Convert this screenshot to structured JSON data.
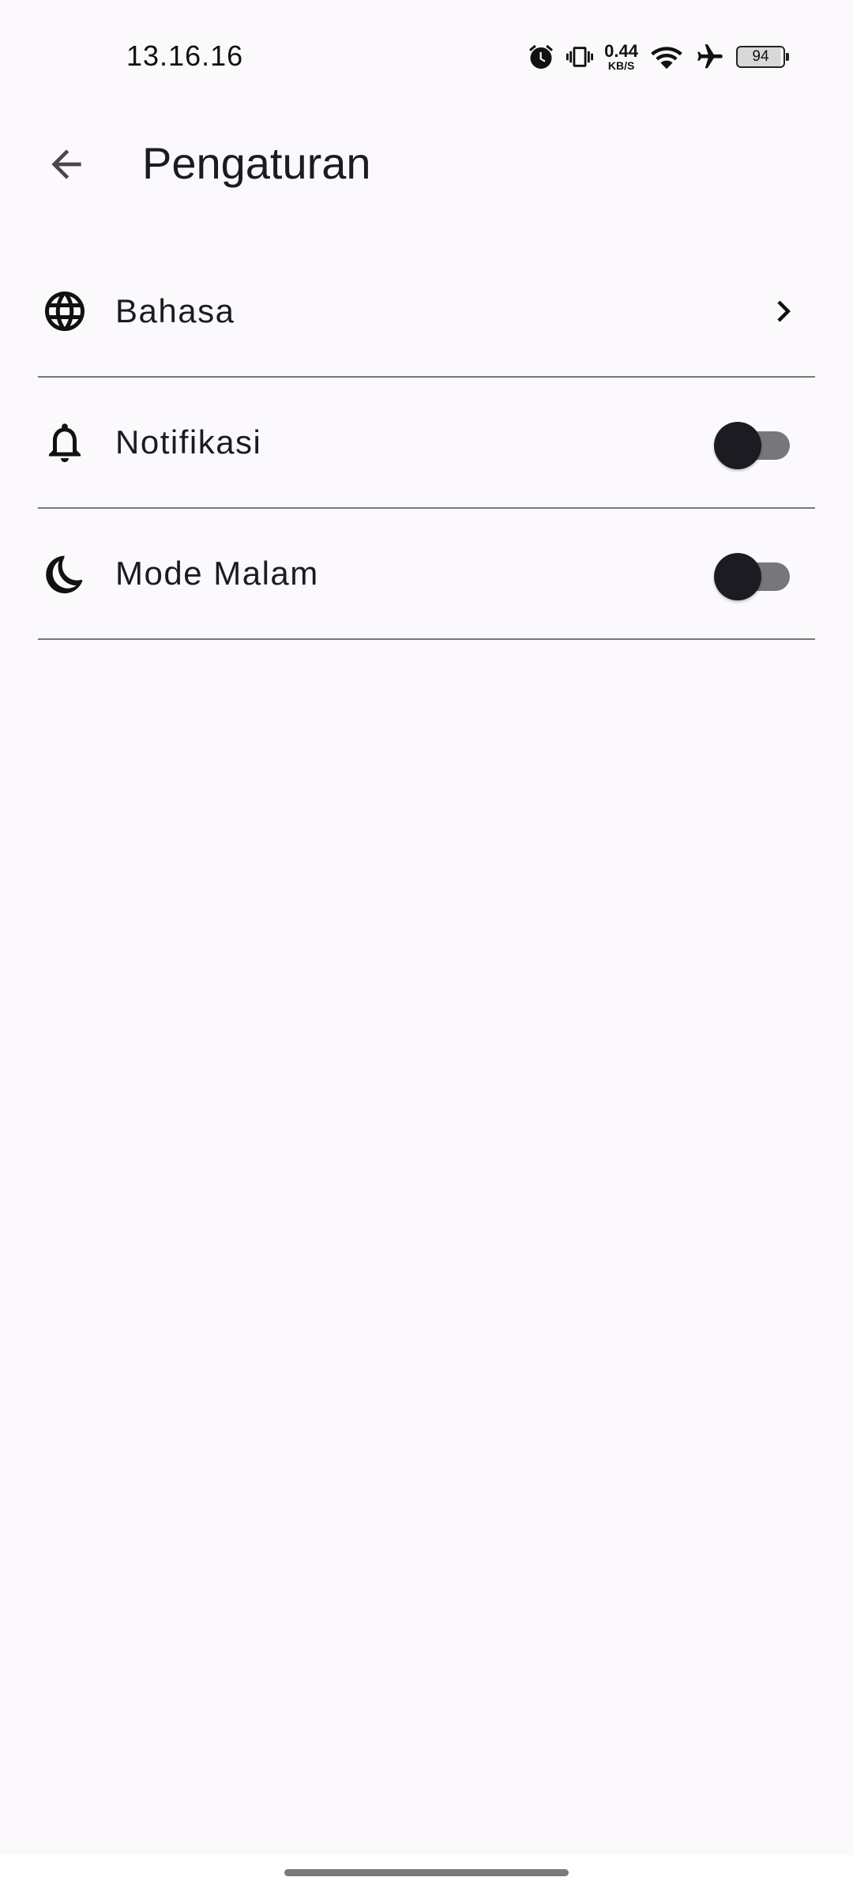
{
  "status_bar": {
    "time": "13.16.16",
    "net_speed_value": "0.44",
    "net_speed_unit": "KB/S",
    "battery_level": "94",
    "icons": [
      "alarm-icon",
      "vibrate-icon",
      "wifi-icon",
      "airplane-icon",
      "battery-icon"
    ]
  },
  "app_bar": {
    "title": "Pengaturan",
    "back_icon": "arrow-back-icon"
  },
  "settings": {
    "items": [
      {
        "label": "Bahasa",
        "icon": "globe-icon",
        "control": "chevron"
      },
      {
        "label": "Notifikasi",
        "icon": "bell-icon",
        "control": "switch",
        "enabled": false
      },
      {
        "label": "Mode Malam",
        "icon": "moon-icon",
        "control": "switch",
        "enabled": false
      }
    ]
  },
  "colors": {
    "background": "#fcf9fc",
    "text": "#1c1b1f",
    "divider": "#7a777c",
    "switch_track": "#77767b",
    "switch_thumb": "#1c1b21"
  }
}
